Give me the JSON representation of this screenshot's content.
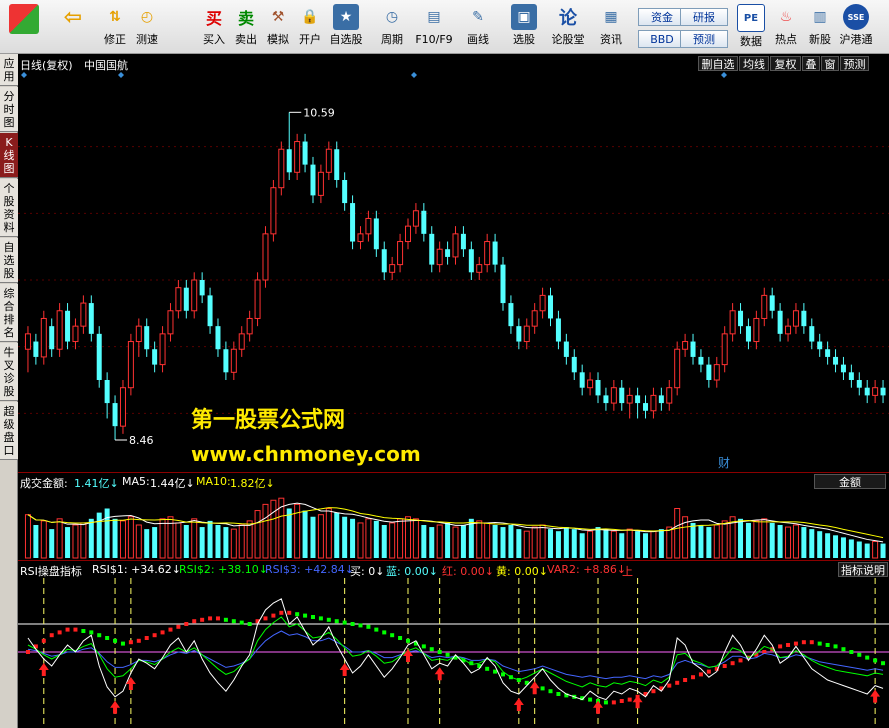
{
  "toolbar": {
    "buttons": [
      {
        "label": "",
        "icon": "grid-icon"
      },
      {
        "label": "",
        "icon": "back-arrow-icon"
      },
      {
        "label": "修正",
        "icon": "arrows-icon"
      },
      {
        "label": "测速",
        "icon": "speed-icon"
      },
      {
        "label": "买入",
        "icon": "buy-icon",
        "glyph": "买"
      },
      {
        "label": "卖出",
        "icon": "sell-icon",
        "glyph": "卖"
      },
      {
        "label": "模拟",
        "icon": "hammer-icon"
      },
      {
        "label": "开户",
        "icon": "lock-icon"
      },
      {
        "label": "自选股",
        "icon": "star-icon"
      },
      {
        "label": "周期",
        "icon": "clock-icon"
      },
      {
        "label": "F10/F9",
        "icon": "document-icon"
      },
      {
        "label": "画线",
        "icon": "pen-icon"
      },
      {
        "label": "选股",
        "icon": "screen-icon"
      },
      {
        "label": "论股堂",
        "icon": "forum-icon",
        "glyph": "论"
      },
      {
        "label": "资讯",
        "icon": "news-icon"
      },
      {
        "label": "数据",
        "icon": "pe-icon",
        "glyph": "PE"
      },
      {
        "label": "热点",
        "icon": "hot-icon"
      },
      {
        "label": "新股",
        "icon": "newstock-icon"
      },
      {
        "label": "沪港通",
        "icon": "hk-icon"
      }
    ],
    "small_buttons": [
      "资金",
      "BBD",
      "研报",
      "预测"
    ]
  },
  "sidebar": {
    "tabs": [
      "应用",
      "分时图",
      "K线图",
      "个股资料",
      "自选股",
      "综合排名",
      "牛叉诊股",
      "超级盘口"
    ]
  },
  "main": {
    "title": "日线(复权)",
    "stock_name": "中国国航",
    "controls": [
      "删自选",
      "均线",
      "复权",
      "叠",
      "窗",
      "预测"
    ],
    "high_label": "10.59",
    "low_label": "8.46",
    "cai_marker": "财"
  },
  "watermark": {
    "line1": "第一股票公式网",
    "line2": "www.chnmoney.com"
  },
  "volume": {
    "label": "成交金额:",
    "value": "1.41亿↓",
    "ma5_label": "MA5:",
    "ma5_value": "1.44亿↓",
    "ma10_label": "MA10:",
    "ma10_value": "1.82亿↓",
    "button": "金额"
  },
  "indicator": {
    "name": "RSI操盘指标",
    "rsi1": "RSI$1: +34.62↓",
    "rsi2": "RSI$2: +38.10↓",
    "rsi3": "RSI$3: +42.84↓",
    "buy": "买: 0↓",
    "blue": "蓝: 0.00↓",
    "red": "红: 0.00↓",
    "yellow": "黄: 0.00↓",
    "var2": "VAR2: +8.86↓",
    "up": "上",
    "button": "指标说明"
  },
  "colors": {
    "up": "#ff3232",
    "down": "#54ffff",
    "ma5": "#ffffff",
    "ma10": "#ffff00",
    "rsi1": "#ffffff",
    "rsi2": "#00ff00",
    "rsi3": "#4466ff"
  },
  "chart_data": {
    "type": "candlestick",
    "y_range_price": [
      8.2,
      10.8
    ],
    "candles": [
      [
        9.05,
        9.15,
        8.9,
        9.2
      ],
      [
        9.1,
        9.0,
        8.95,
        9.15
      ],
      [
        9.0,
        9.25,
        8.95,
        9.3
      ],
      [
        9.2,
        9.05,
        9.0,
        9.25
      ],
      [
        9.05,
        9.3,
        9.0,
        9.35
      ],
      [
        9.3,
        9.1,
        9.05,
        9.35
      ],
      [
        9.1,
        9.2,
        9.05,
        9.25
      ],
      [
        9.2,
        9.35,
        9.15,
        9.4
      ],
      [
        9.35,
        9.15,
        9.1,
        9.4
      ],
      [
        9.15,
        8.85,
        8.8,
        9.2
      ],
      [
        8.85,
        8.7,
        8.6,
        8.9
      ],
      [
        8.7,
        8.55,
        8.46,
        8.75
      ],
      [
        8.55,
        8.8,
        8.5,
        8.85
      ],
      [
        8.8,
        9.1,
        8.75,
        9.15
      ],
      [
        9.1,
        9.2,
        9.0,
        9.25
      ],
      [
        9.2,
        9.05,
        9.0,
        9.25
      ],
      [
        9.05,
        8.95,
        8.9,
        9.1
      ],
      [
        8.95,
        9.15,
        8.9,
        9.2
      ],
      [
        9.15,
        9.3,
        9.1,
        9.35
      ],
      [
        9.3,
        9.45,
        9.25,
        9.5
      ],
      [
        9.45,
        9.3,
        9.25,
        9.5
      ],
      [
        9.3,
        9.5,
        9.25,
        9.55
      ],
      [
        9.5,
        9.4,
        9.35,
        9.55
      ],
      [
        9.4,
        9.2,
        9.15,
        9.45
      ],
      [
        9.2,
        9.05,
        9.0,
        9.25
      ],
      [
        9.05,
        8.9,
        8.85,
        9.1
      ],
      [
        8.9,
        9.05,
        8.85,
        9.1
      ],
      [
        9.05,
        9.15,
        9.0,
        9.2
      ],
      [
        9.15,
        9.25,
        9.1,
        9.3
      ],
      [
        9.25,
        9.5,
        9.2,
        9.55
      ],
      [
        9.5,
        9.8,
        9.45,
        9.85
      ],
      [
        9.8,
        10.1,
        9.75,
        10.15
      ],
      [
        10.1,
        10.35,
        10.05,
        10.4
      ],
      [
        10.35,
        10.2,
        10.15,
        10.59
      ],
      [
        10.2,
        10.4,
        10.15,
        10.45
      ],
      [
        10.4,
        10.25,
        10.2,
        10.45
      ],
      [
        10.25,
        10.05,
        10.0,
        10.3
      ],
      [
        10.05,
        10.2,
        10.0,
        10.25
      ],
      [
        10.2,
        10.35,
        10.15,
        10.4
      ],
      [
        10.35,
        10.15,
        10.1,
        10.4
      ],
      [
        10.15,
        10.0,
        9.95,
        10.2
      ],
      [
        10.0,
        9.75,
        9.7,
        10.05
      ],
      [
        9.75,
        9.8,
        9.7,
        9.85
      ],
      [
        9.8,
        9.9,
        9.75,
        9.95
      ],
      [
        9.9,
        9.7,
        9.65,
        9.95
      ],
      [
        9.7,
        9.55,
        9.5,
        9.75
      ],
      [
        9.55,
        9.6,
        9.5,
        9.65
      ],
      [
        9.6,
        9.75,
        9.55,
        9.8
      ],
      [
        9.75,
        9.85,
        9.7,
        9.9
      ],
      [
        9.85,
        9.95,
        9.8,
        10.0
      ],
      [
        9.95,
        9.8,
        9.75,
        10.0
      ],
      [
        9.8,
        9.6,
        9.55,
        9.85
      ],
      [
        9.6,
        9.7,
        9.55,
        9.75
      ],
      [
        9.7,
        9.65,
        9.6,
        9.75
      ],
      [
        9.65,
        9.8,
        9.6,
        9.85
      ],
      [
        9.8,
        9.7,
        9.65,
        9.85
      ],
      [
        9.7,
        9.55,
        9.5,
        9.75
      ],
      [
        9.55,
        9.6,
        9.5,
        9.65
      ],
      [
        9.6,
        9.75,
        9.55,
        9.8
      ],
      [
        9.75,
        9.6,
        9.55,
        9.8
      ],
      [
        9.6,
        9.35,
        9.3,
        9.65
      ],
      [
        9.35,
        9.2,
        9.15,
        9.4
      ],
      [
        9.2,
        9.1,
        9.05,
        9.25
      ],
      [
        9.1,
        9.2,
        9.05,
        9.25
      ],
      [
        9.2,
        9.3,
        9.15,
        9.35
      ],
      [
        9.3,
        9.4,
        9.25,
        9.45
      ],
      [
        9.4,
        9.25,
        9.2,
        9.45
      ],
      [
        9.25,
        9.1,
        9.05,
        9.3
      ],
      [
        9.1,
        9.0,
        8.95,
        9.15
      ],
      [
        9.0,
        8.9,
        8.85,
        9.05
      ],
      [
        8.9,
        8.8,
        8.75,
        8.95
      ],
      [
        8.8,
        8.85,
        8.75,
        8.9
      ],
      [
        8.85,
        8.75,
        8.7,
        8.9
      ],
      [
        8.75,
        8.7,
        8.65,
        8.8
      ],
      [
        8.7,
        8.8,
        8.65,
        8.85
      ],
      [
        8.8,
        8.7,
        8.65,
        8.85
      ],
      [
        8.7,
        8.75,
        8.6,
        8.8
      ],
      [
        8.75,
        8.7,
        8.6,
        8.8
      ],
      [
        8.7,
        8.65,
        8.6,
        8.75
      ],
      [
        8.65,
        8.75,
        8.6,
        8.8
      ],
      [
        8.75,
        8.7,
        8.65,
        8.8
      ],
      [
        8.7,
        8.8,
        8.65,
        8.85
      ],
      [
        8.8,
        9.05,
        8.75,
        9.1
      ],
      [
        9.05,
        9.1,
        9.0,
        9.15
      ],
      [
        9.1,
        9.0,
        8.95,
        9.15
      ],
      [
        9.0,
        8.95,
        8.9,
        9.05
      ],
      [
        8.95,
        8.85,
        8.8,
        9.0
      ],
      [
        8.85,
        8.95,
        8.8,
        9.0
      ],
      [
        8.95,
        9.15,
        8.9,
        9.2
      ],
      [
        9.15,
        9.3,
        9.1,
        9.35
      ],
      [
        9.3,
        9.2,
        9.15,
        9.35
      ],
      [
        9.2,
        9.1,
        9.05,
        9.25
      ],
      [
        9.1,
        9.25,
        9.05,
        9.3
      ],
      [
        9.25,
        9.4,
        9.2,
        9.45
      ],
      [
        9.4,
        9.3,
        9.25,
        9.45
      ],
      [
        9.3,
        9.15,
        9.1,
        9.35
      ],
      [
        9.15,
        9.2,
        9.1,
        9.25
      ],
      [
        9.2,
        9.3,
        9.15,
        9.35
      ],
      [
        9.3,
        9.2,
        9.15,
        9.35
      ],
      [
        9.2,
        9.1,
        9.05,
        9.25
      ],
      [
        9.1,
        9.05,
        9.0,
        9.15
      ],
      [
        9.05,
        9.0,
        8.95,
        9.1
      ],
      [
        9.0,
        8.95,
        8.9,
        9.05
      ],
      [
        8.95,
        8.9,
        8.85,
        9.0
      ],
      [
        8.9,
        8.85,
        8.8,
        8.95
      ],
      [
        8.85,
        8.8,
        8.75,
        8.9
      ],
      [
        8.8,
        8.75,
        8.7,
        8.85
      ],
      [
        8.75,
        8.8,
        8.7,
        8.85
      ],
      [
        8.8,
        8.75,
        8.7,
        8.85
      ]
    ],
    "volume_y_range": [
      0,
      3.2
    ],
    "volumes": [
      2.1,
      1.6,
      1.8,
      1.4,
      1.9,
      1.5,
      1.6,
      1.7,
      1.9,
      2.2,
      2.4,
      1.9,
      1.8,
      2.0,
      1.6,
      1.4,
      1.5,
      1.9,
      2.0,
      1.7,
      1.6,
      1.9,
      1.5,
      1.8,
      1.6,
      1.5,
      1.4,
      1.6,
      1.8,
      2.3,
      2.6,
      2.8,
      2.9,
      2.4,
      2.6,
      2.3,
      2.0,
      2.1,
      2.4,
      2.2,
      2.0,
      1.9,
      1.7,
      1.9,
      1.8,
      1.6,
      1.7,
      1.9,
      2.0,
      1.9,
      1.6,
      1.5,
      1.6,
      1.7,
      1.5,
      1.6,
      1.9,
      1.8,
      1.7,
      1.6,
      1.5,
      1.6,
      1.4,
      1.3,
      1.5,
      1.6,
      1.4,
      1.3,
      1.5,
      1.4,
      1.2,
      1.3,
      1.5,
      1.4,
      1.3,
      1.2,
      1.4,
      1.3,
      1.2,
      1.3,
      1.4,
      1.5,
      2.4,
      2.0,
      1.7,
      1.6,
      1.5,
      1.6,
      1.8,
      2.0,
      1.9,
      1.7,
      1.8,
      1.9,
      1.7,
      1.6,
      1.5,
      1.6,
      1.5,
      1.4,
      1.3,
      1.2,
      1.1,
      1.0,
      0.9,
      0.8,
      0.7,
      0.8,
      0.7
    ],
    "rsi_y_range": [
      0,
      100
    ],
    "rsi1": [
      60,
      52,
      45,
      40,
      48,
      55,
      50,
      58,
      62,
      40,
      25,
      18,
      22,
      35,
      45,
      42,
      38,
      46,
      55,
      60,
      50,
      58,
      45,
      35,
      28,
      22,
      30,
      40,
      48,
      70,
      80,
      85,
      88,
      70,
      75,
      65,
      55,
      60,
      68,
      55,
      45,
      35,
      40,
      48,
      40,
      32,
      38,
      46,
      55,
      58,
      48,
      38,
      42,
      40,
      48,
      42,
      35,
      38,
      46,
      40,
      28,
      22,
      20,
      26,
      32,
      38,
      30,
      24,
      20,
      18,
      16,
      22,
      18,
      16,
      22,
      20,
      24,
      22,
      18,
      26,
      22,
      30,
      60,
      55,
      42,
      38,
      32,
      36,
      50,
      62,
      55,
      44,
      52,
      62,
      55,
      42,
      46,
      54,
      46,
      38,
      34,
      30,
      28,
      26,
      24,
      22,
      20,
      26,
      24
    ],
    "rsi2": [
      55,
      52,
      48,
      45,
      48,
      52,
      51,
      54,
      56,
      48,
      38,
      32,
      33,
      38,
      44,
      43,
      41,
      45,
      50,
      53,
      50,
      53,
      48,
      43,
      38,
      34,
      36,
      41,
      45,
      58,
      66,
      71,
      75,
      68,
      70,
      65,
      60,
      61,
      64,
      59,
      53,
      47,
      48,
      51,
      47,
      42,
      43,
      47,
      51,
      53,
      49,
      44,
      45,
      44,
      47,
      45,
      41,
      42,
      45,
      43,
      36,
      32,
      30,
      32,
      35,
      38,
      35,
      32,
      29,
      27,
      25,
      28,
      26,
      25,
      28,
      27,
      29,
      28,
      26,
      30,
      28,
      32,
      48,
      49,
      44,
      42,
      39,
      40,
      46,
      53,
      51,
      46,
      49,
      54,
      52,
      46,
      47,
      51,
      48,
      44,
      41,
      39,
      37,
      36,
      35,
      34,
      33,
      35,
      34
    ],
    "rsi3": [
      52,
      51,
      49,
      47,
      48,
      50,
      50,
      52,
      53,
      49,
      43,
      39,
      39,
      41,
      44,
      44,
      43,
      45,
      48,
      50,
      49,
      51,
      48,
      45,
      42,
      39,
      40,
      42,
      45,
      52,
      58,
      62,
      65,
      62,
      63,
      61,
      58,
      58,
      60,
      57,
      54,
      50,
      50,
      51,
      49,
      46,
      46,
      48,
      50,
      51,
      49,
      46,
      47,
      46,
      47,
      46,
      44,
      44,
      45,
      44,
      40,
      38,
      36,
      37,
      38,
      40,
      38,
      36,
      34,
      33,
      32,
      33,
      32,
      31,
      32,
      32,
      33,
      32,
      31,
      33,
      32,
      34,
      42,
      44,
      42,
      41,
      39,
      40,
      43,
      47,
      47,
      45,
      46,
      49,
      48,
      46,
      46,
      48,
      47,
      45,
      43,
      42,
      41,
      40,
      39,
      38,
      37,
      38,
      37
    ],
    "dot_line": [
      50,
      54,
      58,
      62,
      64,
      66,
      66,
      65,
      64,
      62,
      60,
      58,
      56,
      57,
      58,
      60,
      62,
      64,
      66,
      68,
      70,
      72,
      73,
      74,
      74,
      73,
      72,
      71,
      70,
      72,
      74,
      76,
      78,
      78,
      77,
      76,
      75,
      74,
      73,
      72,
      71,
      70,
      69,
      68,
      66,
      64,
      62,
      60,
      58,
      56,
      54,
      52,
      50,
      48,
      46,
      44,
      42,
      40,
      38,
      36,
      34,
      32,
      30,
      28,
      26,
      24,
      22,
      20,
      19,
      18,
      17,
      16,
      15,
      14,
      14,
      15,
      16,
      18,
      20,
      22,
      24,
      26,
      28,
      30,
      32,
      34,
      36,
      38,
      40,
      42,
      44,
      46,
      48,
      50,
      52,
      54,
      55,
      56,
      57,
      57,
      56,
      55,
      54,
      52,
      50,
      48,
      46,
      44,
      42
    ],
    "buy_signals": [
      2,
      11,
      13,
      40,
      48,
      52,
      62,
      64,
      72,
      77,
      107
    ],
    "signal_lines": [
      2,
      11,
      13,
      40,
      48,
      52,
      62,
      64,
      72,
      77,
      107
    ]
  }
}
